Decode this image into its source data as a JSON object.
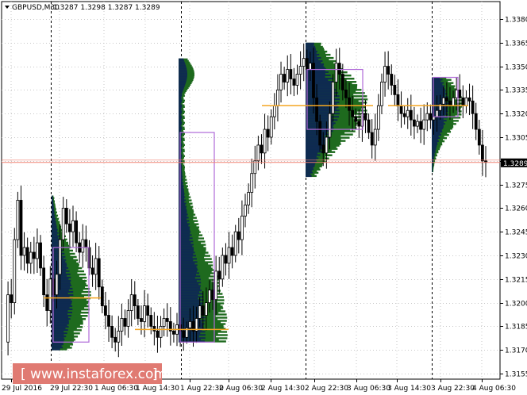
{
  "chart_data": {
    "type": "candlestick",
    "title": "GBPUSD,M30",
    "ohlc_header": "1.3287 1.3298 1.3287 1.3289",
    "current_price_label": "1.3289",
    "current_price": 1.3289,
    "reference_line_price": 1.3289,
    "ylim": [
      1.3155,
      1.3385
    ],
    "y_ticks": [
      "1.3380",
      "1.3365",
      "1.3350",
      "1.3335",
      "1.3320",
      "1.3305",
      "1.3290",
      "1.3275",
      "1.3260",
      "1.3245",
      "1.3230",
      "1.3215",
      "1.3200",
      "1.3185",
      "1.3170",
      "1.3155"
    ],
    "y_tick_values": [
      1.338,
      1.3365,
      1.335,
      1.3335,
      1.332,
      1.3305,
      1.329,
      1.3275,
      1.326,
      1.3245,
      1.323,
      1.3215,
      1.32,
      1.3185,
      1.317,
      1.3155
    ],
    "x_ticks": [
      "29 Jul 2016",
      "29 Jul 22:30",
      "1 Aug 06:30",
      "1 Aug 14:30",
      "1 Aug 22:30",
      "2 Aug 06:30",
      "2 Aug 14:30",
      "2 Aug 22:30",
      "3 Aug 06:30",
      "3 Aug 14:30",
      "3 Aug 22:30",
      "4 Aug 06:30"
    ],
    "session_separators": [
      "29 Jul 22:30",
      "1 Aug 22:30",
      "2 Aug 22:30",
      "3 Aug 22:30"
    ],
    "close_path": [
      1.3175,
      1.3205,
      1.32,
      1.324,
      1.3265,
      1.323,
      1.3235,
      1.3225,
      1.3232,
      1.3228,
      1.3238,
      1.3222,
      1.3205,
      1.3195,
      1.3215,
      1.3205,
      1.3218,
      1.324,
      1.326,
      1.325,
      1.3245,
      1.3252,
      1.3238,
      1.3232,
      1.324,
      1.3235,
      1.3222,
      1.3218,
      1.3228,
      1.321,
      1.3198,
      1.3192,
      1.3185,
      1.3178,
      1.3175,
      1.3182,
      1.319,
      1.3185,
      1.3195,
      1.3205,
      1.3198,
      1.319,
      1.3188,
      1.3198,
      1.3192,
      1.3185,
      1.3182,
      1.3178,
      1.3185,
      1.319,
      1.3188,
      1.3182,
      1.318,
      1.3186,
      1.3182,
      1.3178,
      1.3184,
      1.3188,
      1.3182,
      1.319,
      1.3198,
      1.3192,
      1.32,
      1.3208,
      1.3202,
      1.322,
      1.3215,
      1.323,
      1.3225,
      1.3235,
      1.323,
      1.3245,
      1.324,
      1.3255,
      1.3262,
      1.327,
      1.3282,
      1.329,
      1.33,
      1.3295,
      1.331,
      1.3305,
      1.3318,
      1.3325,
      1.3335,
      1.3345,
      1.334,
      1.3348,
      1.3342,
      1.3338,
      1.3345,
      1.335,
      1.3355,
      1.3348,
      1.3352,
      1.333,
      1.3315,
      1.33,
      1.3295,
      1.3305,
      1.332,
      1.334,
      1.3352,
      1.3345,
      1.3335,
      1.333,
      1.3322,
      1.3318,
      1.3315,
      1.3312,
      1.332,
      1.3316,
      1.3308,
      1.33,
      1.331,
      1.3325,
      1.334,
      1.335,
      1.3345,
      1.3338,
      1.3332,
      1.3325,
      1.332,
      1.3318,
      1.3322,
      1.3316,
      1.3312,
      1.3315,
      1.331,
      1.3316,
      1.332,
      1.3316,
      1.3318,
      1.3322,
      1.3326,
      1.333,
      1.3328,
      1.3325,
      1.333,
      1.3335,
      1.333,
      1.3325,
      1.333,
      1.3328,
      1.332,
      1.331,
      1.33,
      1.329,
      1.3289
    ],
    "volume_profiles": [
      {
        "session": "29 Jul 22:30",
        "poc": 1.3203,
        "value_area": [
          1.3175,
          1.3235
        ],
        "range": [
          1.317,
          1.3268
        ]
      },
      {
        "session": "1 Aug 22:30",
        "poc": 1.3183,
        "value_area": [
          1.3175,
          1.3308
        ],
        "range": [
          1.3175,
          1.3355
        ]
      },
      {
        "session": "2 Aug 22:30",
        "poc": 1.3325,
        "value_area": [
          1.331,
          1.3348
        ],
        "range": [
          1.328,
          1.3365
        ]
      },
      {
        "session": "3 Aug 22:30",
        "poc": 1.3325,
        "value_area": [
          1.3318,
          1.3343
        ],
        "range": [
          1.3283,
          1.3343
        ]
      }
    ],
    "colors": {
      "candle": "#000000",
      "poc_line": "#f5a623",
      "value_area_box": "#b06ad8",
      "profile_dark": "#0c1e5a",
      "profile_light": "#1e6a1e",
      "price_line": "#f08070",
      "current_price_tag": "#000000"
    }
  },
  "branding": {
    "logo_text": "www.instaforex.com",
    "logo_bg": "#e07a72"
  }
}
